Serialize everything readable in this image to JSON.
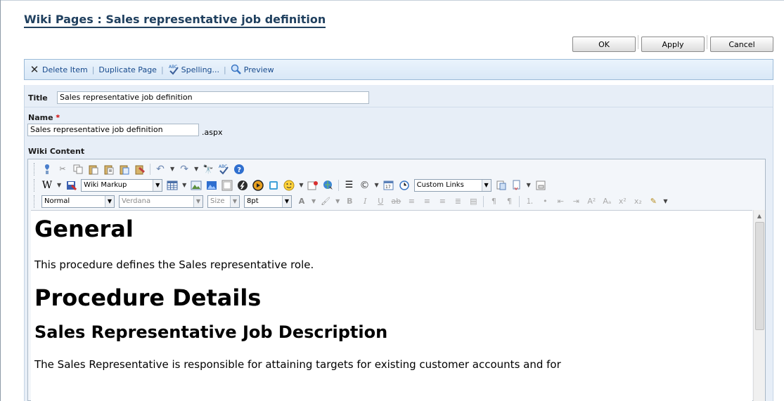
{
  "page_title": {
    "list": "Wiki Pages",
    "separator": ":",
    "item": "Sales representative job definition"
  },
  "buttons": {
    "ok": "OK",
    "apply": "Apply",
    "cancel": "Cancel"
  },
  "actions": {
    "delete": "Delete Item",
    "duplicate": "Duplicate Page",
    "spelling": "Spelling...",
    "preview": "Preview",
    "separator": "|"
  },
  "form": {
    "title_label": "Title",
    "title_value": "Sales representative job definition",
    "name_label": "Name",
    "name_required": "*",
    "name_value": "Sales representative job definition",
    "name_suffix": ".aspx",
    "content_label": "Wiki Content"
  },
  "toolbar": {
    "markup_mode": "Wiki Markup",
    "links": "Custom Links",
    "paragraph_style": "Normal",
    "font_family": "Verdana",
    "size_label": "Size",
    "font_size": "8pt"
  },
  "content": {
    "h1_general": "General",
    "p_intro": "This procedure defines the Sales representative role.",
    "h1_details": "Procedure Details",
    "h2_job": "Sales Representative Job Description",
    "p_body": "The Sales Representative is responsible for attaining targets for existing customer accounts and for"
  },
  "colors": {
    "title": "#20405f",
    "action_text": "#16498c",
    "form_bg": "#e7eef7",
    "required": "#d00000"
  }
}
